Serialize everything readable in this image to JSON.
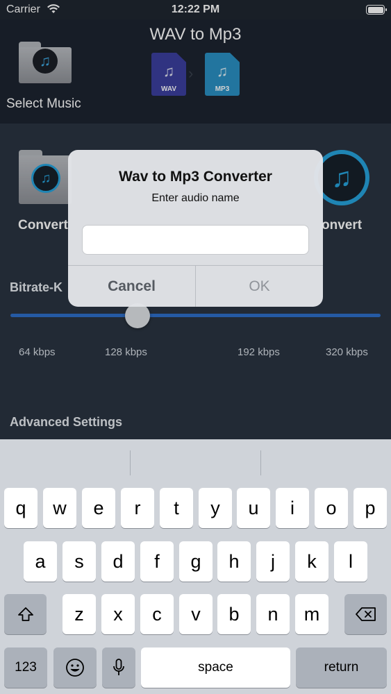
{
  "status_bar": {
    "carrier": "Carrier",
    "time": "12:22 PM"
  },
  "header": {
    "title": "WAV to Mp3",
    "select_music": "Select Music",
    "source_format": "WAV",
    "target_format": "MP3"
  },
  "main": {
    "convert_left": "Convert",
    "convert_right": "onvert",
    "bitrate_label": "Bitrate-K",
    "bitrate_ticks": [
      "64 kbps",
      "128 kbps",
      "192 kbps",
      "320 kbps"
    ],
    "selected_bitrate": "128 kbps",
    "advanced_settings": "Advanced Settings"
  },
  "alert": {
    "title": "Wav to Mp3 Converter",
    "message": "Enter audio name",
    "input_value": "",
    "cancel": "Cancel",
    "ok": "OK"
  },
  "keyboard": {
    "row1": [
      "q",
      "w",
      "e",
      "r",
      "t",
      "y",
      "u",
      "i",
      "o",
      "p"
    ],
    "row2": [
      "a",
      "s",
      "d",
      "f",
      "g",
      "h",
      "j",
      "k",
      "l"
    ],
    "row3": [
      "z",
      "x",
      "c",
      "v",
      "b",
      "n",
      "m"
    ],
    "numbers": "123",
    "space": "space",
    "return": "return"
  },
  "colors": {
    "accent": "#27a3dc",
    "slider": "#2e6ec8",
    "wav_icon": "#3b3f9e",
    "mp3_icon": "#2a8fc2"
  }
}
